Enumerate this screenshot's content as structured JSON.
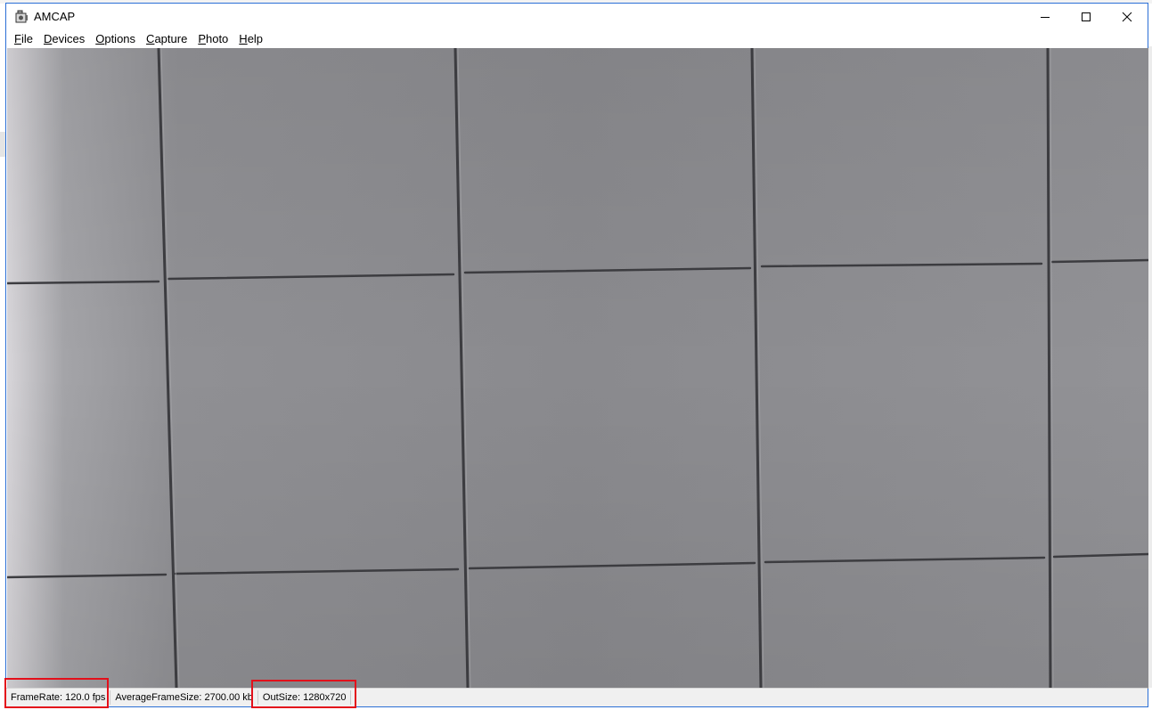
{
  "window": {
    "title": "AMCAP",
    "app_icon": "camera-icon",
    "caption_buttons": [
      "minimize-icon",
      "maximize-icon",
      "close-icon"
    ]
  },
  "menu": {
    "items": [
      {
        "accel": "F",
        "rest": "ile"
      },
      {
        "accel": "D",
        "rest": "evices"
      },
      {
        "accel": "O",
        "rest": "ptions"
      },
      {
        "accel": "C",
        "rest": "apture"
      },
      {
        "accel": "P",
        "rest": "hoto"
      },
      {
        "accel": "H",
        "rest": "elp"
      }
    ]
  },
  "statusbar": {
    "frame_rate": "FrameRate: 120.0 fps",
    "avg_frame_size": "AverageFrameSize: 2700.00 kb",
    "out_size": "OutSize: 1280x720"
  },
  "colors": {
    "window_border": "#2b6fd6",
    "highlight_box": "#e3101b",
    "preview_gray": "#8c8c90",
    "grout_line": "#3c3c40"
  }
}
